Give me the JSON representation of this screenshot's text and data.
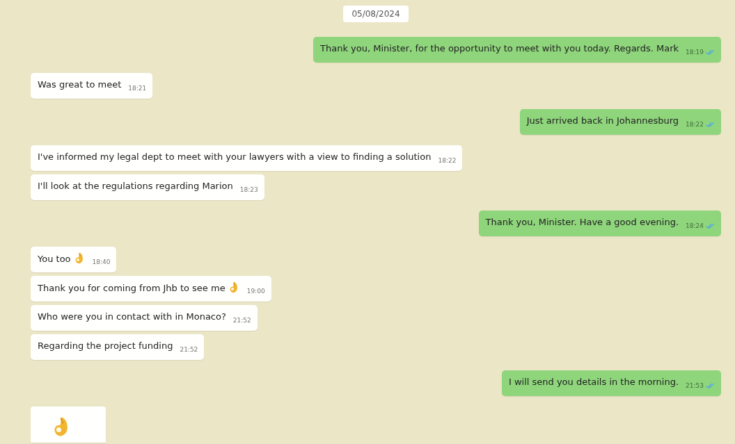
{
  "date_label": "05/08/2024",
  "messages": [
    {
      "kind": "outgoing",
      "text": "Thank you, Minister, for the opportunity to meet with you today. Regards. Mark",
      "time": "18:19",
      "read": true
    },
    {
      "kind": "incoming",
      "text": "Was great to meet",
      "time": "18:21"
    },
    {
      "kind": "outgoing",
      "text": "Just arrived back in Johannesburg",
      "time": "18:22",
      "read": true
    },
    {
      "kind": "incoming",
      "text": "I've informed my legal dept to meet with your lawyers with a view to finding a solution",
      "time": "18:22"
    },
    {
      "kind": "incoming",
      "text": "I'll look at the regulations regarding Marion",
      "time": "18:23"
    },
    {
      "kind": "outgoing",
      "text": "Thank you, Minister. Have a good evening.",
      "time": "18:24",
      "read": true
    },
    {
      "kind": "incoming",
      "text": "You too",
      "emoji": true,
      "time": "18:40"
    },
    {
      "kind": "incoming",
      "text": "Thank you for coming from Jhb to see me",
      "emoji": true,
      "time": "19:00"
    },
    {
      "kind": "incoming",
      "text": "Who were you in contact with in Monaco?",
      "time": "21:52"
    },
    {
      "kind": "incoming",
      "text": "Regarding the project funding",
      "time": "21:52"
    },
    {
      "kind": "outgoing",
      "text": "I will send you details in the morning.",
      "time": "21:53",
      "read": true
    },
    {
      "kind": "incoming_emoji"
    }
  ]
}
